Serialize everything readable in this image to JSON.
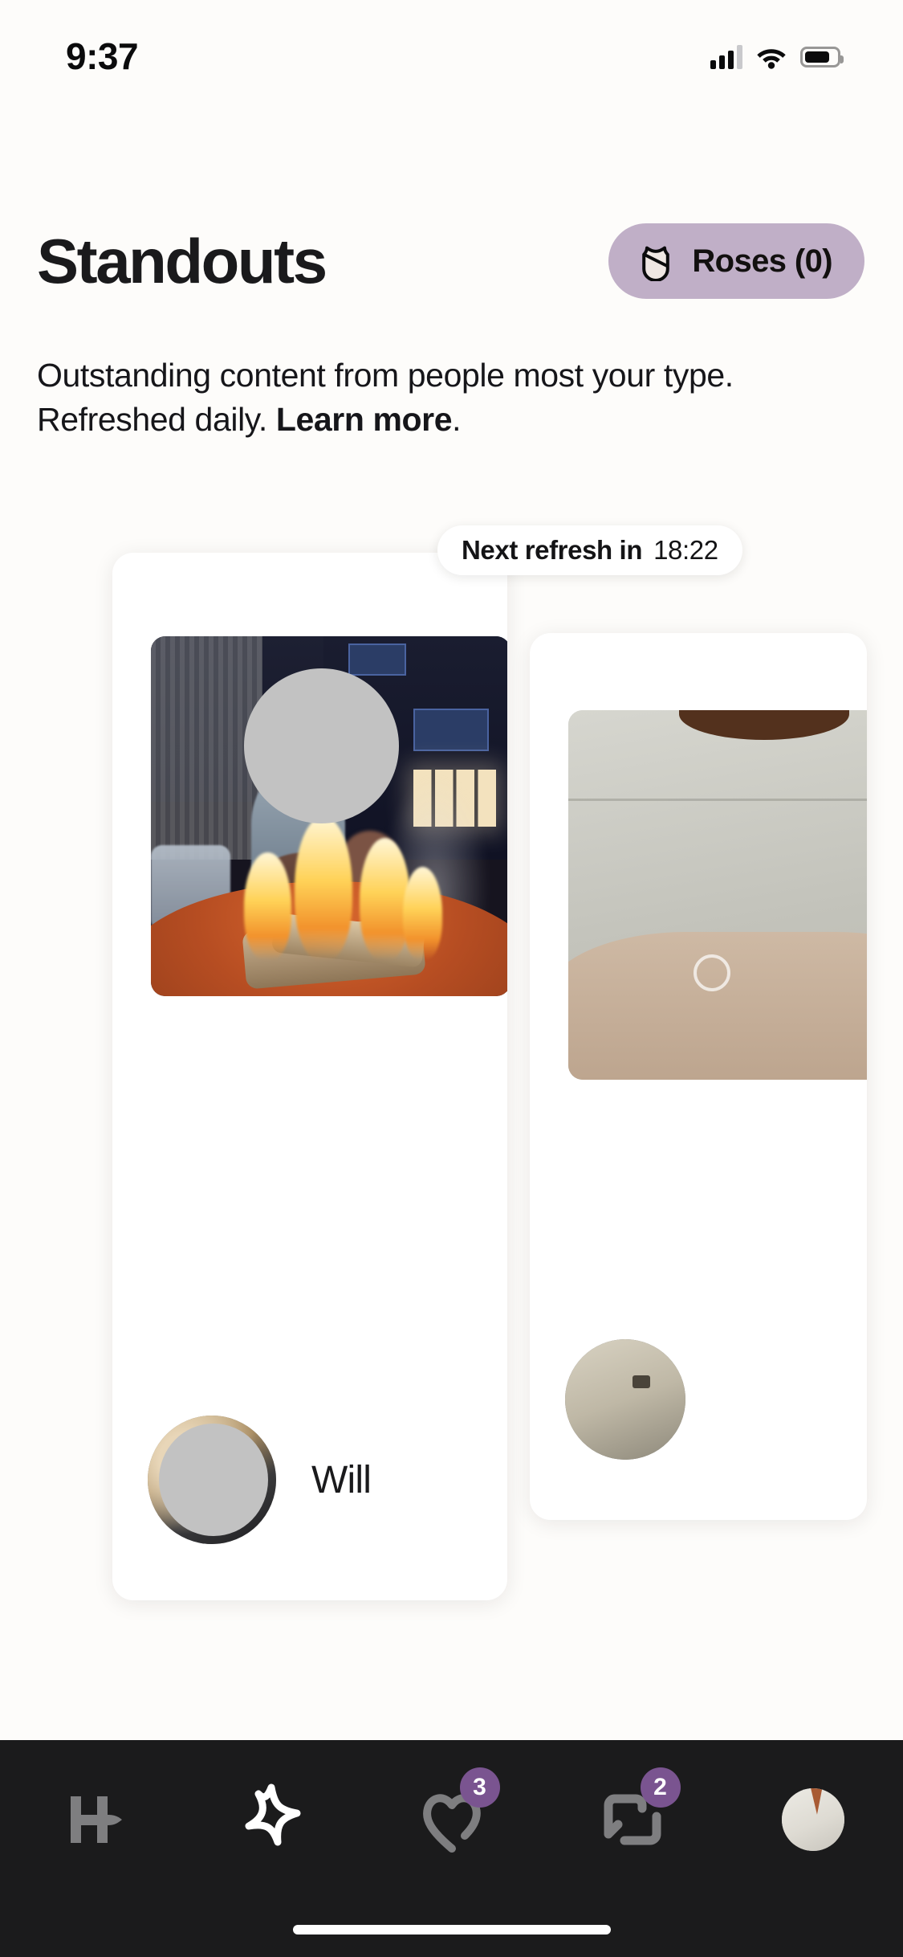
{
  "status_bar": {
    "time": "9:37",
    "cellular_icon": "cellular-signal-icon",
    "wifi_icon": "wifi-icon",
    "battery_icon": "battery-icon"
  },
  "header": {
    "title": "Standouts",
    "roses_button": {
      "label": "Roses (0)",
      "count": 0,
      "icon": "rose-icon",
      "background_color": "#C0AFC7"
    }
  },
  "subtitle": {
    "text_before": "Outstanding content from people most your type. Refreshed daily. ",
    "link_text": "Learn more",
    "text_after": "."
  },
  "refresh_pill": {
    "label": "Next refresh in",
    "timer": "18:22"
  },
  "cards": [
    {
      "name": "Will",
      "photo_description": "person sitting by an outdoor fire pit at night",
      "face_redacted": true,
      "avatar_redacted": true
    },
    {
      "name": "",
      "photo_description": "person in tan shirt indoors",
      "face_redacted": false,
      "avatar_redacted": false
    }
  ],
  "bottom_nav": {
    "accent_color": "#7A5490",
    "background_color": "#1B1B1C",
    "items": [
      {
        "name": "discover",
        "icon": "hinge-logo-icon",
        "badge": "",
        "active": false
      },
      {
        "name": "standouts",
        "icon": "star-icon",
        "badge": "",
        "active": true
      },
      {
        "name": "likes",
        "icon": "heart-icon",
        "badge": "3",
        "active": false
      },
      {
        "name": "matches",
        "icon": "chat-bubbles-icon",
        "badge": "2",
        "active": false
      },
      {
        "name": "profile",
        "icon": "profile-avatar-icon",
        "badge": "",
        "active": false
      }
    ]
  }
}
